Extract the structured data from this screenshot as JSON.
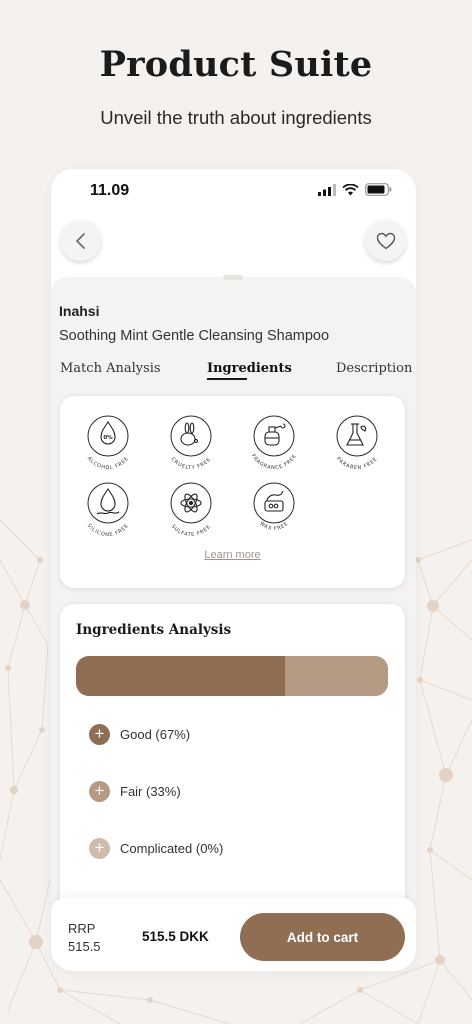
{
  "hero": {
    "title": "Product Suite",
    "subtitle": "Unveil the truth about ingredients"
  },
  "status_bar": {
    "time": "11.09",
    "icons": [
      "signal-icon",
      "wifi-icon",
      "battery-icon"
    ]
  },
  "nav": {
    "back_icon": "chevron-left-icon",
    "favorite_icon": "heart-icon"
  },
  "product": {
    "brand": "Inahsi",
    "name": "Soothing Mint Gentle Cleansing Shampoo"
  },
  "tabs": [
    {
      "label": "Match Analysis",
      "active": false
    },
    {
      "label": "Ingredients",
      "active": true
    },
    {
      "label": "Description",
      "active": false
    }
  ],
  "badges": [
    {
      "label": "ALCOHOL FREE",
      "icon": "drop-zero-percent-icon"
    },
    {
      "label": "CRUELTY FREE",
      "icon": "rabbit-icon"
    },
    {
      "label": "FRAGRANCE FREE",
      "icon": "perfume-bottle-icon"
    },
    {
      "label": "PARABEN FREE",
      "icon": "flask-icon"
    },
    {
      "label": "SILICONE FREE",
      "icon": "silicone-drop-icon"
    },
    {
      "label": "SULFATE FREE",
      "icon": "atom-icon"
    },
    {
      "label": "WAX FREE",
      "icon": "wax-jar-icon"
    }
  ],
  "learn_more": "Learn more",
  "analysis": {
    "title": "Ingredients Analysis",
    "segments": [
      {
        "label": "Good (67%)",
        "percent": 67,
        "color": "#8f6e54"
      },
      {
        "label": "Fair (33%)",
        "percent": 33,
        "color": "#b59a83"
      },
      {
        "label": "Complicated (0%)",
        "percent": 0,
        "color": "#cdbcae"
      }
    ]
  },
  "footer": {
    "rrp_label": "RRP",
    "rrp_value": "515.5",
    "price": "515.5 DKK",
    "cta": "Add to cart"
  },
  "colors": {
    "accent": "#8f6e54",
    "accent_light": "#b59a83",
    "background": "#f4f1ee"
  }
}
